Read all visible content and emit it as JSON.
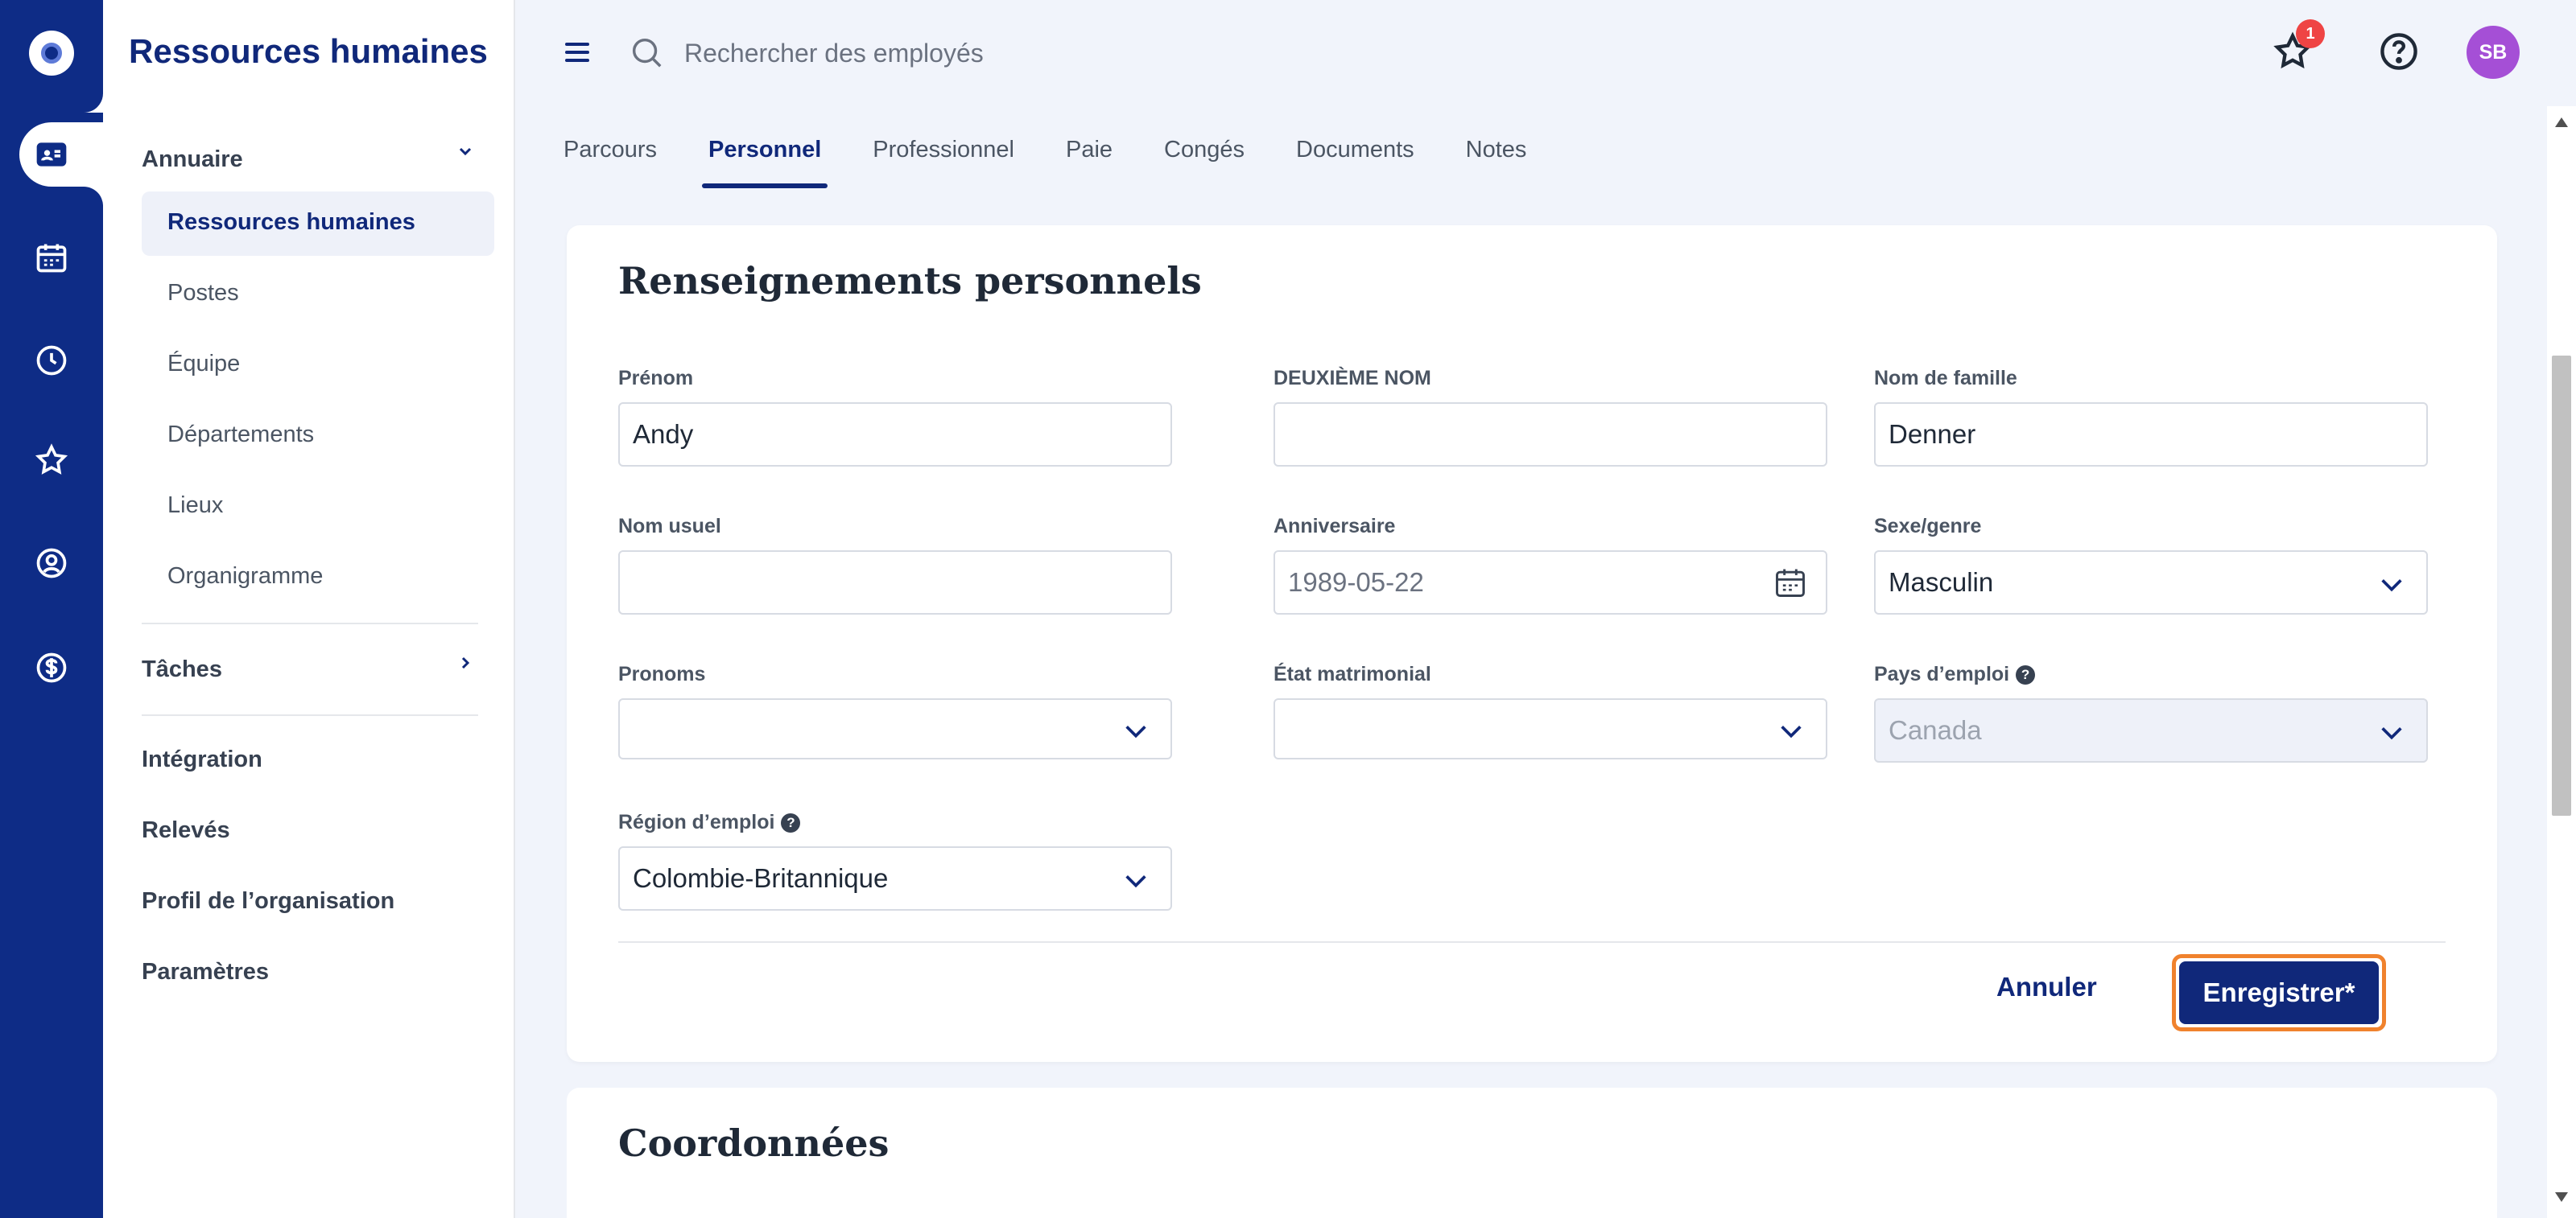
{
  "sidebar": {
    "title": "Ressources humaines",
    "sections": [
      {
        "label": "Annuaire",
        "caret": "⌄"
      },
      {
        "label": "Tâches",
        "caret": "›"
      }
    ],
    "annuaire_items": [
      "Ressources humaines",
      "Postes",
      "Équipe",
      "Départements",
      "Lieux",
      "Organigramme"
    ],
    "other_items": [
      "Intégration",
      "Relevés",
      "Profil de l’organisation",
      "Paramètres"
    ]
  },
  "rail": {
    "icons": [
      "logo-icon",
      "directory-card-icon",
      "calendar-icon",
      "clock-icon",
      "star-icon",
      "person-search-icon",
      "dollar-icon"
    ]
  },
  "topbar": {
    "search_placeholder": "Rechercher des employés",
    "notification_count": "1",
    "avatar_initials": "SB"
  },
  "tabs": [
    "Parcours",
    "Personnel",
    "Professionnel",
    "Paie",
    "Congés",
    "Documents",
    "Notes"
  ],
  "active_tab": "Personnel",
  "form": {
    "title": "Renseignements personnels",
    "fields": {
      "first_name": {
        "label": "Prénom",
        "value": "Andy"
      },
      "middle_name": {
        "label": "DEUXIÈME NOM",
        "value": ""
      },
      "last_name": {
        "label": "Nom de famille",
        "value": "Denner"
      },
      "preferred_name": {
        "label": "Nom usuel",
        "value": ""
      },
      "birthday": {
        "label": "Anniversaire",
        "value": "1989-05-22"
      },
      "gender": {
        "label": "Sexe/genre",
        "value": "Masculin"
      },
      "pronouns": {
        "label": "Pronoms",
        "value": ""
      },
      "marital_status": {
        "label": "État matrimonial",
        "value": ""
      },
      "work_country": {
        "label": "Pays d’emploi",
        "value": "Canada"
      },
      "work_region": {
        "label": "Région d’emploi",
        "value": "Colombie-Britannique"
      }
    },
    "cancel_label": "Annuler",
    "save_label": "Enregistrer*"
  },
  "second_card": {
    "title": "Coordonnées"
  },
  "colors": {
    "brand": "#0e2c86",
    "accent_outline": "#f0822d",
    "badge": "#ef4444",
    "avatar": "#a54fd6"
  }
}
